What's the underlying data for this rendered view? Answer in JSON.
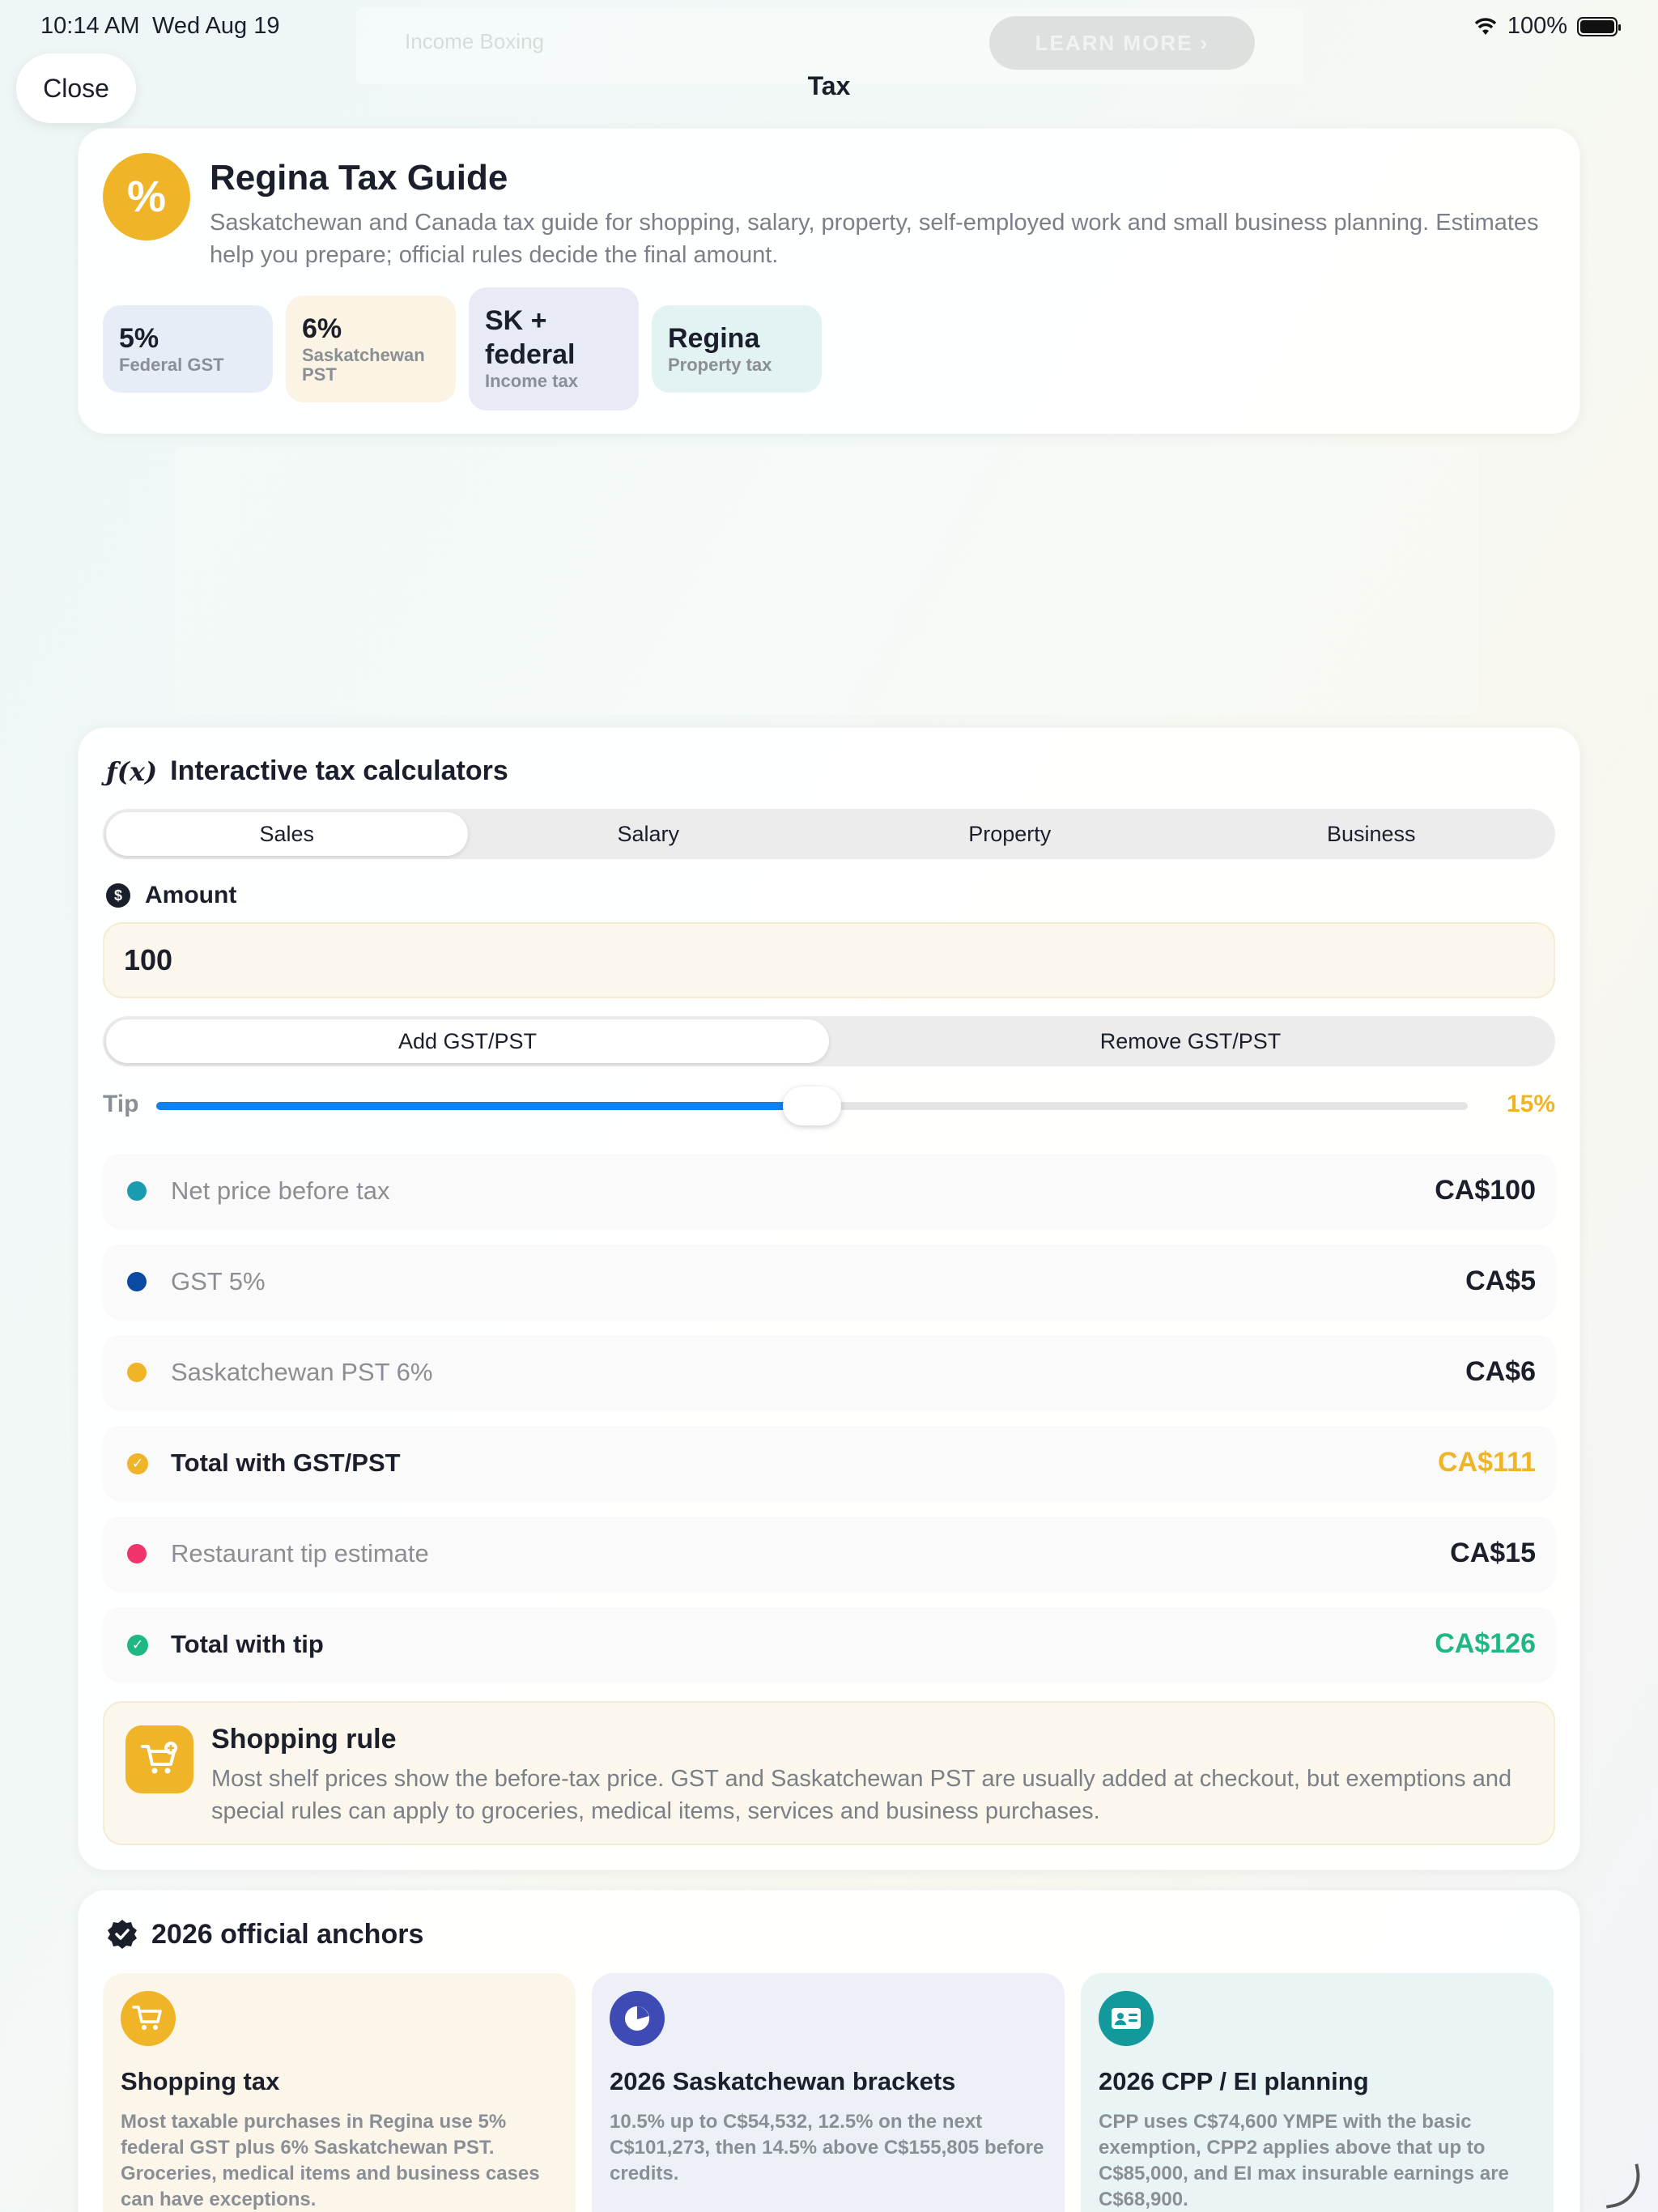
{
  "status": {
    "time": "10:14 AM",
    "date": "Wed Aug 19",
    "battery": "100%"
  },
  "ghost": {
    "text": "Income Boxing",
    "button": "LEARN MORE ›"
  },
  "nav": {
    "close": "Close",
    "title": "Tax"
  },
  "hero": {
    "icon": "%",
    "title": "Regina Tax Guide",
    "description": "Saskatchewan and Canada tax guide for shopping, salary, property, self-employed work and small business planning. Estimates help you prepare; official rules decide the final amount.",
    "chips": [
      {
        "value": "5%",
        "label": "Federal GST"
      },
      {
        "value": "6%",
        "label": "Saskatchewan PST"
      },
      {
        "value": "SK + federal",
        "label": "Income tax"
      },
      {
        "value": "Regina",
        "label": "Property tax"
      }
    ]
  },
  "calculator": {
    "icon": "ƒ(x)",
    "title": "Interactive tax calculators",
    "tabs": [
      "Sales",
      "Salary",
      "Property",
      "Business"
    ],
    "active_tab": "Sales",
    "amount_label": "Amount",
    "amount_value": "100",
    "modes": [
      "Add GST/PST",
      "Remove GST/PST"
    ],
    "active_mode": "Add GST/PST",
    "tip_label": "Tip",
    "tip_value": "15%",
    "tip_fraction": 0.5,
    "rows": [
      {
        "label": "Net price before tax",
        "value": "CA$100",
        "marker": "dot",
        "color": "#1a9bb0"
      },
      {
        "label": "GST 5%",
        "value": "CA$5",
        "marker": "dot",
        "color": "#0b4aa2"
      },
      {
        "label": "Saskatchewan PST 6%",
        "value": "CA$6",
        "marker": "dot",
        "color": "#f0b429"
      },
      {
        "label": "Total with GST/PST",
        "value": "CA$111",
        "marker": "check",
        "color": "#f0b429"
      },
      {
        "label": "Restaurant tip estimate",
        "value": "CA$15",
        "marker": "dot",
        "color": "#f0336a"
      },
      {
        "label": "Total with tip",
        "value": "CA$126",
        "marker": "check",
        "color": "#1fb884"
      }
    ],
    "rule": {
      "title": "Shopping rule",
      "text": "Most shelf prices show the before-tax price. GST and Saskatchewan PST are usually added at checkout, but exemptions and special rules can apply to groceries, medical items, services and business purchases."
    }
  },
  "anchors": {
    "title": "2026 official anchors",
    "cards": [
      {
        "icon": "cart-icon",
        "color": "#f0b429",
        "title": "Shopping tax",
        "text": "Most taxable purchases in Regina use 5% federal GST plus 6% Saskatchewan PST. Groceries, medical items and business cases can have exceptions."
      },
      {
        "icon": "pie-chart-icon",
        "color": "#3f4bb5",
        "title": "2026 Saskatchewan brackets",
        "text": "10.5% up to C$54,532, 12.5% on the next C$101,273, then 14.5% above C$155,805 before credits."
      },
      {
        "icon": "id-card-icon",
        "color": "#13989c",
        "title": "2026 CPP / EI planning",
        "text": "CPP uses C$74,600 YMPE with the basic exemption, CPP2 applies above that up to C$85,000, and EI max insurable earnings are C$68,900."
      }
    ]
  }
}
